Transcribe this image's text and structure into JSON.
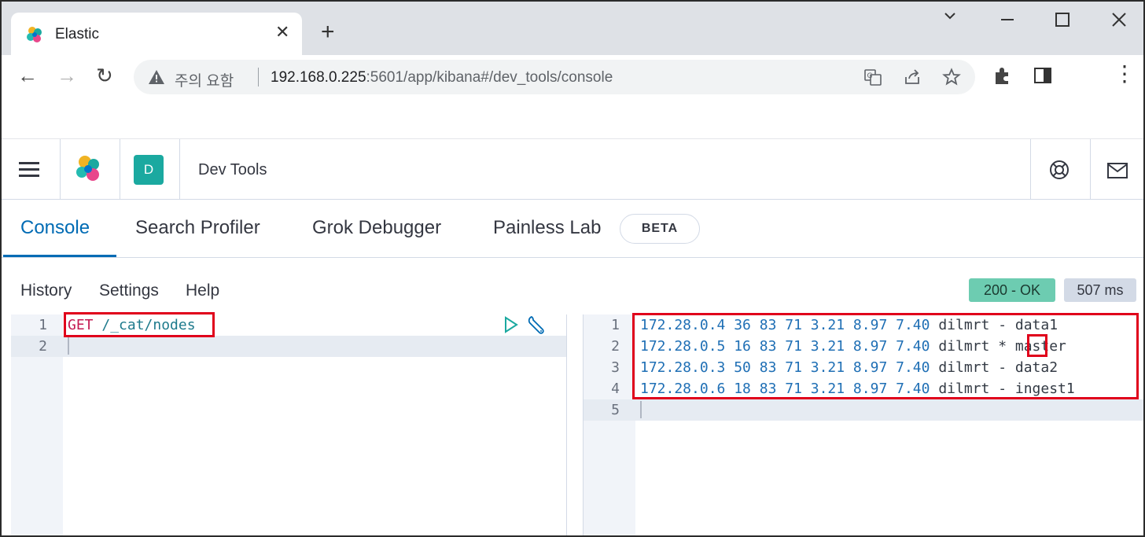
{
  "browser": {
    "tab_title": "Elastic",
    "tab_close": "✕",
    "new_tab": "+",
    "window_controls": {
      "minimize": "—",
      "maximize": "☐",
      "close": "✕",
      "menu": "⌄"
    },
    "security_warning": "주의 요함",
    "url_host": "192.168.0.225",
    "url_rest": ":5601/app/kibana#/dev_tools/console",
    "nav": {
      "back": "←",
      "forward": "→",
      "reload": "↻"
    },
    "menu_dots": "⋮"
  },
  "kibana": {
    "space_initial": "D",
    "page_title": "Dev Tools"
  },
  "devtools": {
    "tabs": [
      {
        "label": "Console",
        "active": true
      },
      {
        "label": "Search Profiler",
        "active": false
      },
      {
        "label": "Grok Debugger",
        "active": false
      },
      {
        "label": "Painless Lab",
        "active": false
      }
    ],
    "beta_badge": "BETA",
    "menu": [
      "History",
      "Settings",
      "Help"
    ],
    "status": "200 - OK",
    "time": "507 ms"
  },
  "request_editor": {
    "line_numbers": [
      "1",
      "2"
    ],
    "method": "GET",
    "path": " /_cat/nodes"
  },
  "response_editor": {
    "line_numbers": [
      "1",
      "2",
      "3",
      "4",
      "5"
    ],
    "rows": [
      {
        "ip": "172.28.0.4",
        "metrics": "36 83 71 3.21 8.97 7.40",
        "role": "dilmrt",
        "master": "-",
        "name": "data1"
      },
      {
        "ip": "172.28.0.5",
        "metrics": "16 83 71 3.21 8.97 7.40",
        "role": "dilmrt",
        "master": "*",
        "name": "master"
      },
      {
        "ip": "172.28.0.3",
        "metrics": "50 83 71 3.21 8.97 7.40",
        "role": "dilmrt",
        "master": "-",
        "name": "data2"
      },
      {
        "ip": "172.28.0.6",
        "metrics": "18 83 71 3.21 8.97 7.40",
        "role": "dilmrt",
        "master": "-",
        "name": "ingest1"
      }
    ]
  },
  "colors": {
    "accent": "#006bb4",
    "ok_badge": "#6dccb1",
    "highlight_box": "#e0001b",
    "space_avatar": "#1ba9a0"
  }
}
